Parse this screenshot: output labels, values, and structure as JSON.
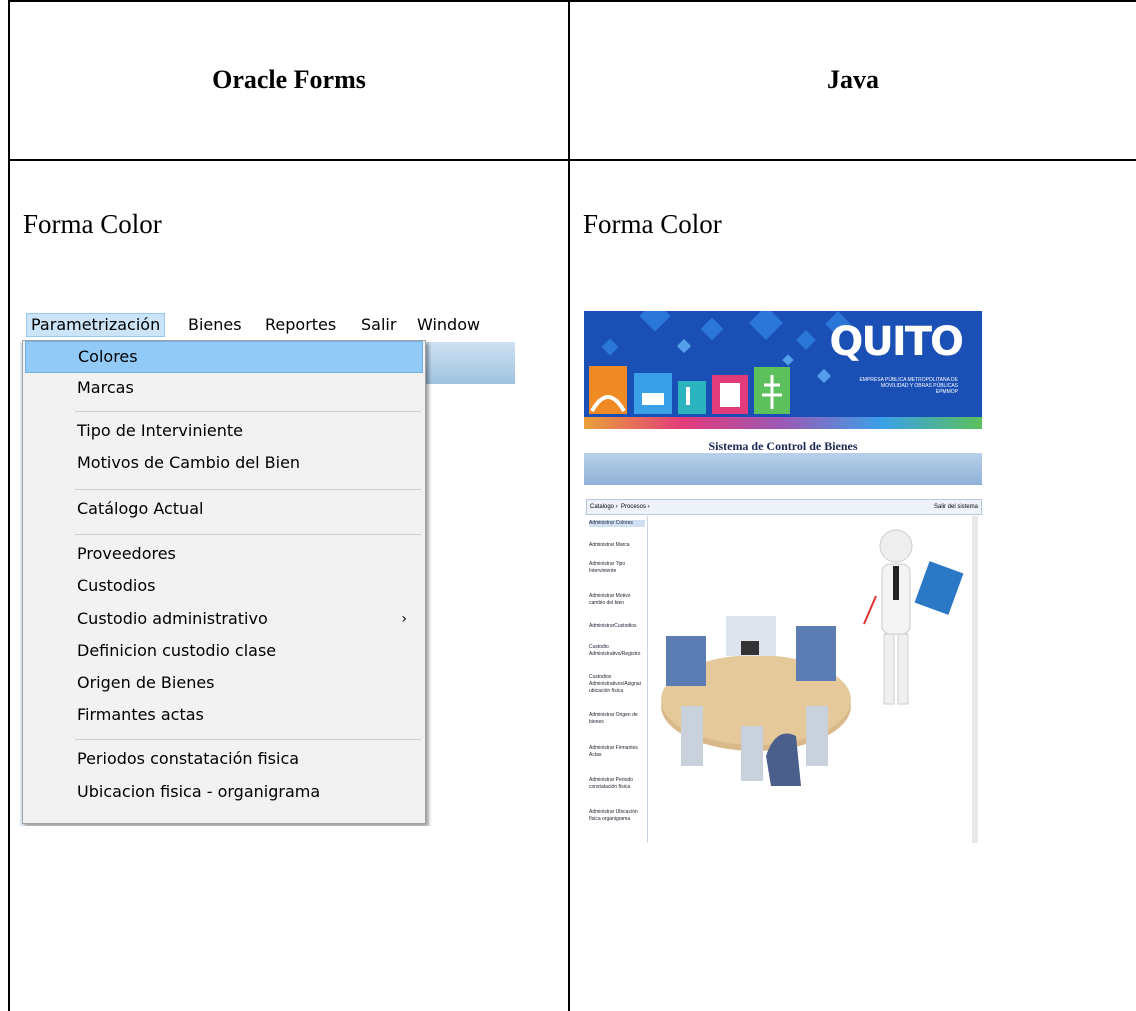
{
  "table": {
    "col1_header": "Oracle Forms",
    "col2_header": "Java",
    "col1_label": "Forma Color",
    "col2_label": "Forma Color"
  },
  "oracle_forms": {
    "menubar": [
      "Parametrización",
      "Bienes",
      "Reportes",
      "Salir",
      "Window"
    ],
    "active_menu": "Parametrización",
    "menu_items": [
      {
        "label": "Colores",
        "selected": true
      },
      {
        "label": "Marcas"
      },
      {
        "label": "Tipo de Interviniente"
      },
      {
        "label": "Motivos de Cambio del Bien"
      },
      {
        "label": "Catálogo Actual"
      },
      {
        "label": "Proveedores"
      },
      {
        "label": "Custodios"
      },
      {
        "label": "Custodio administrativo",
        "submenu_arrow": "›"
      },
      {
        "label": "Definicion custodio clase"
      },
      {
        "label": "Origen de Bienes"
      },
      {
        "label": "Firmantes actas"
      },
      {
        "label": "Periodos constatación fisica"
      },
      {
        "label": "Ubicacion fisica - organigrama"
      }
    ]
  },
  "java": {
    "logo": "QUITO",
    "logo_sub": "EMPRESA PÚBLICA METROPOLITANA DE MOVILIDAD Y OBRAS PÚBLICAS EPMMOP",
    "app_title": "Sistema de Control de Bienes",
    "nav_catalogo": "Catalogo ›",
    "nav_procesos": "Procesos ›",
    "nav_salir": "Salir del sistema",
    "sidebar": [
      "Administrar Colores",
      "Administrar Marca",
      "Administrar Tipo Interviniente",
      "Administrar Motivo cambio del bien",
      "AdministrarCustodios",
      "Custodio Administrativo/Registro",
      "Custodios Administrativos/Asignar ubicación física",
      "Administrar Origen de bienes",
      "Administrar Firmantes Actas",
      "Administrar Periodo constatación física",
      "Administrar Ubicación física organigrama"
    ]
  }
}
